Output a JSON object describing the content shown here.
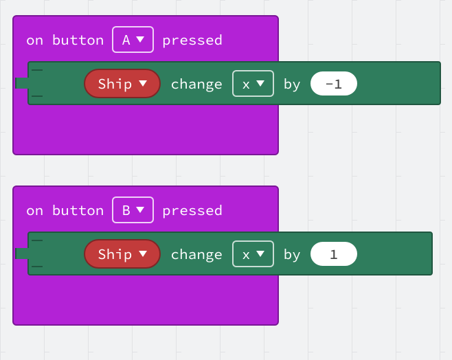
{
  "colors": {
    "event_block": "#b322d6",
    "sprite_block": "#2f7d5d",
    "variable_pill": "#c23b3b",
    "value_pill_bg": "#ffffff"
  },
  "blocks": [
    {
      "id": "a",
      "header": {
        "prefix": "on button",
        "button": "A",
        "suffix": "pressed"
      },
      "child": {
        "sprite": "Ship",
        "verb": "change",
        "property": "x",
        "by_label": "by",
        "value": "-1"
      }
    },
    {
      "id": "b",
      "header": {
        "prefix": "on button",
        "button": "B",
        "suffix": "pressed"
      },
      "child": {
        "sprite": "Ship",
        "verb": "change",
        "property": "x",
        "by_label": "by",
        "value": "1"
      }
    }
  ]
}
